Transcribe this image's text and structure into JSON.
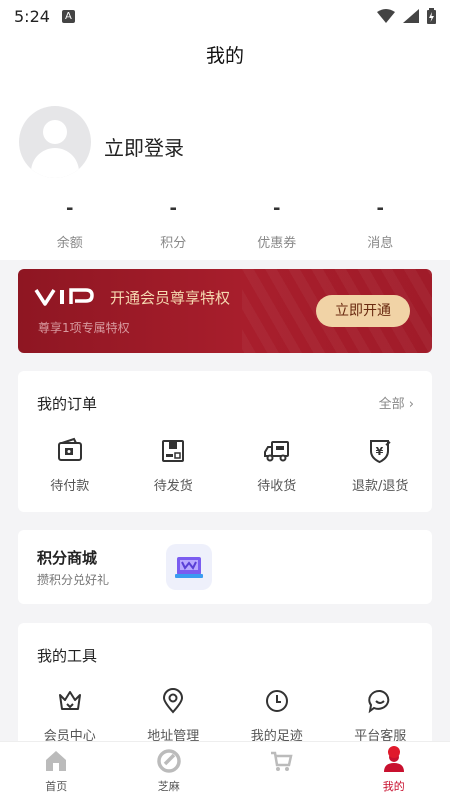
{
  "status": {
    "time": "5:24",
    "badge": "A"
  },
  "title": "我的",
  "profile": {
    "login_label": "立即登录",
    "stats": [
      {
        "value": "-",
        "label": "余额"
      },
      {
        "value": "-",
        "label": "积分"
      },
      {
        "value": "-",
        "label": "优惠券"
      },
      {
        "value": "-",
        "label": "消息"
      }
    ]
  },
  "vip": {
    "logo": "VIP",
    "title": "开通会员尊享特权",
    "subtitle": "尊享1项专属特权",
    "button": "立即开通"
  },
  "orders": {
    "title": "我的订单",
    "more": "全部",
    "items": [
      {
        "label": "待付款",
        "icon": "wallet-icon"
      },
      {
        "label": "待发货",
        "icon": "package-icon"
      },
      {
        "label": "待收货",
        "icon": "truck-icon"
      },
      {
        "label": "退款/退货",
        "icon": "refund-icon"
      }
    ]
  },
  "points_mall": {
    "title": "积分商城",
    "subtitle": "攒积分兑好礼"
  },
  "tools": {
    "title": "我的工具",
    "items": [
      {
        "label": "会员中心",
        "icon": "crown-icon"
      },
      {
        "label": "地址管理",
        "icon": "location-icon"
      },
      {
        "label": "我的足迹",
        "icon": "clock-icon"
      },
      {
        "label": "平台客服",
        "icon": "chat-icon"
      }
    ]
  },
  "tabbar": [
    {
      "label": "首页",
      "icon": "home-icon"
    },
    {
      "label": "芝麻",
      "icon": "sesame-icon"
    },
    {
      "label": "",
      "icon": "cart-icon"
    },
    {
      "label": "我的",
      "icon": "user-icon"
    }
  ],
  "colors": {
    "accent": "#c8102e",
    "vip_bg": "#a81e2c",
    "vip_btn": "#f1d3a6"
  }
}
